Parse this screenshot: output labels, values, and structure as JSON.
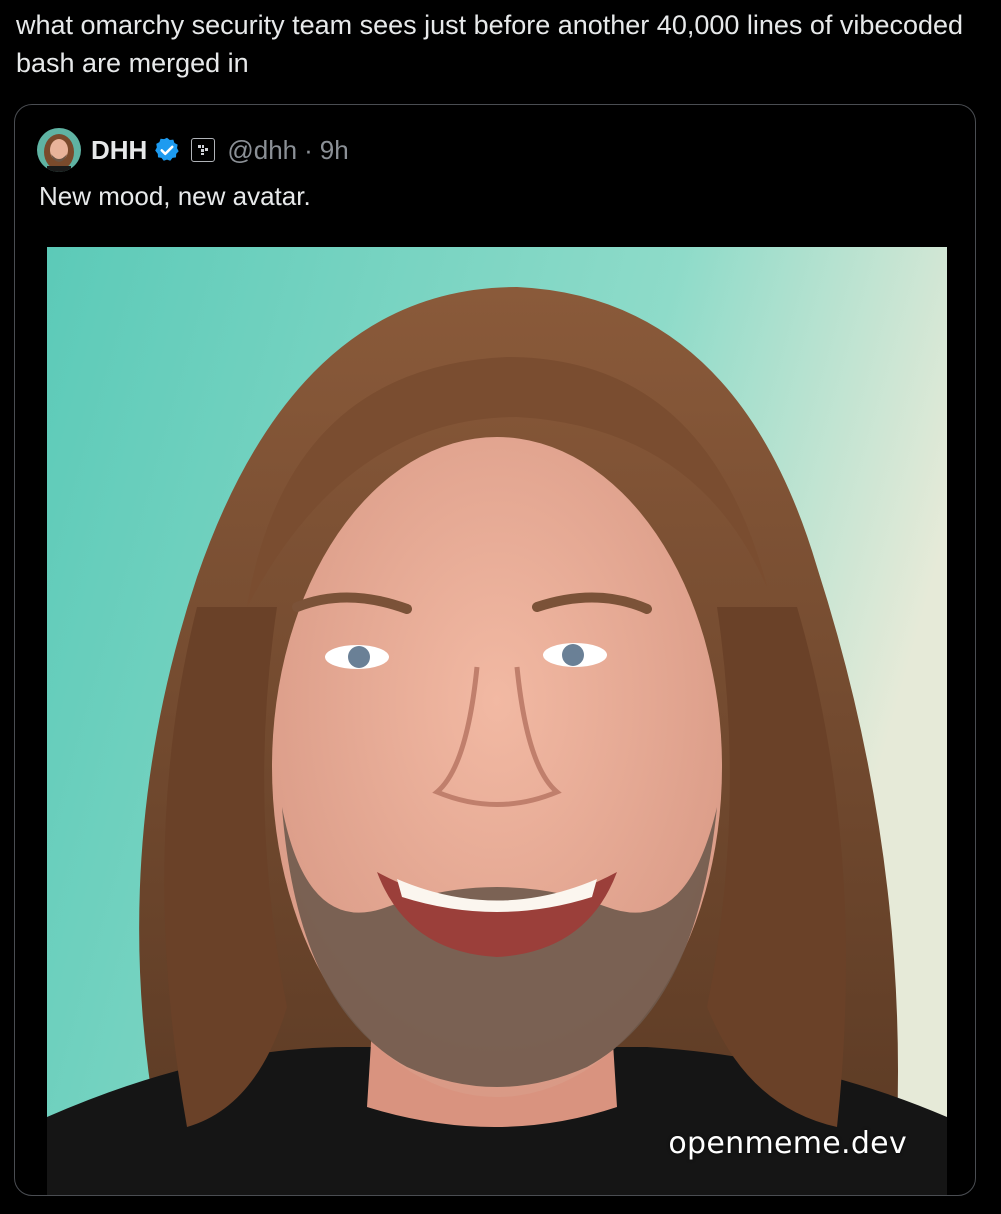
{
  "post": {
    "text": "what omarchy security team sees just before another 40,000 lines of vibecoded bash are merged in"
  },
  "quoted_tweet": {
    "display_name": "DHH",
    "handle": "@dhh",
    "separator": "·",
    "time": "9h",
    "text": "New mood, new avatar.",
    "avatar_icon": "avatar-photo",
    "verified_icon": "verified-badge-icon",
    "affiliate_icon": "affiliate-badge-icon",
    "media_description_icon": "portrait-photo"
  },
  "watermark": {
    "text": "openmeme.dev"
  },
  "colors": {
    "background": "#000000",
    "text": "#e7e9ea",
    "muted": "#8b9096",
    "border": "#4a4d52",
    "verified_blue": "#1d9bf0",
    "photo_background": "#7fd4c4"
  }
}
